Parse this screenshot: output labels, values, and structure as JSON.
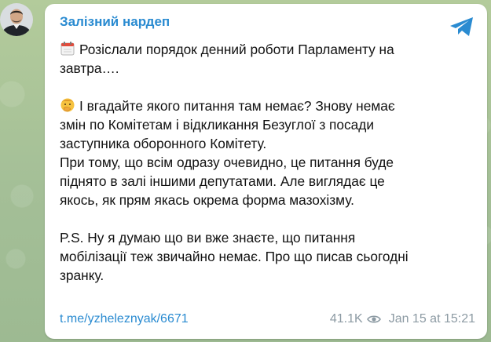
{
  "post": {
    "channel_name": "Залізний нардеп",
    "paragraphs": [
      {
        "emoji": "calendar-icon",
        "lines": [
          "Розіслали порядок денний роботи Парламенту на",
          "завтра…."
        ]
      },
      {
        "emoji": "thinking-face-icon",
        "lines": [
          "І вгадайте якого питання там немає? Знову немає",
          "змін по Комітетам і відкликання Безуглої з посади",
          "заступника оборонного Комітету.",
          "При тому, що всім одразу очевидно, це питання буде",
          "піднято в залі іншими депутатами. Але виглядає це",
          "якось, як прям якась окрема форма мазохізму."
        ]
      },
      {
        "emoji": null,
        "lines": [
          "P.S. Ну я думаю що ви вже знаєте, що питання",
          "мобілізації теж звичайно немає. Про що писав сьогодні",
          "зранку."
        ]
      }
    ],
    "link": "t.me/yzheleznyak/6671",
    "views": "41.1K",
    "date": "Jan 15 at 15:21"
  },
  "colors": {
    "accent": "#2a8bd1",
    "meta": "#8c9aa3",
    "background": "#a8c29a"
  }
}
